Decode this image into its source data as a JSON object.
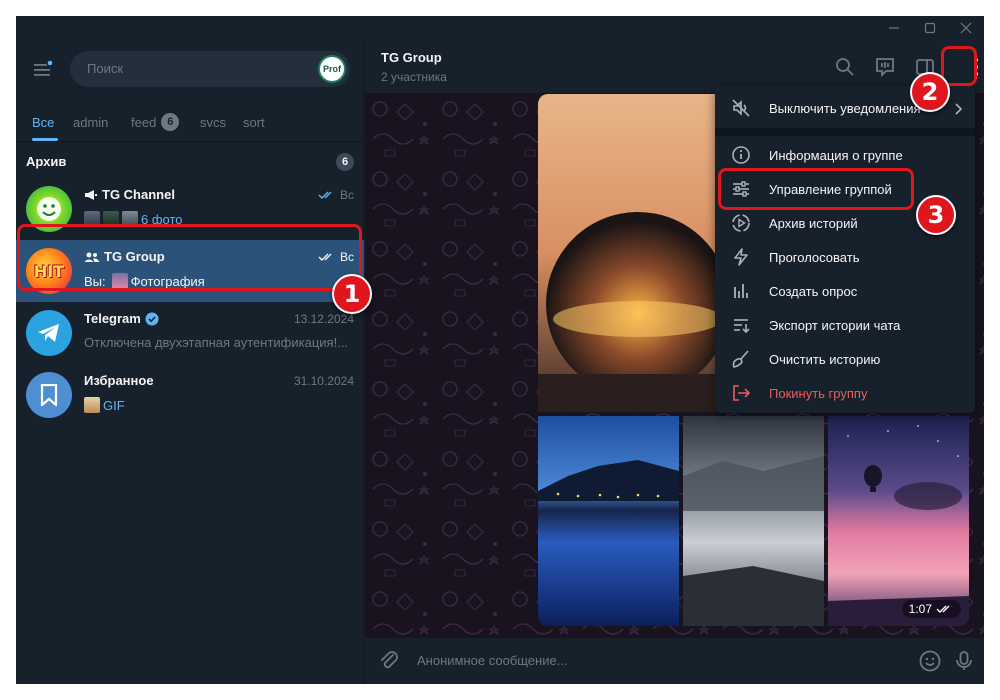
{
  "window": {
    "controls": {
      "minimize": "—",
      "maximize": "☐",
      "close": "✕"
    }
  },
  "sidebar": {
    "search_placeholder": "Поиск",
    "avatar_text": "Prof",
    "tabs": [
      {
        "label": "Все",
        "active": true
      },
      {
        "label": "admin"
      },
      {
        "label": "feed",
        "badge": "6"
      },
      {
        "label": "svcs"
      },
      {
        "label": "sort"
      }
    ],
    "archive": {
      "label": "Архив",
      "badge": "6"
    },
    "chats": [
      {
        "name": "TG Channel",
        "time": "Вс",
        "preview_link": "6 фото"
      },
      {
        "name": "TG Group",
        "time": "Вс",
        "preview_prefix": "Вы:",
        "preview_text": "Фотография",
        "avatar_text": "HIT"
      },
      {
        "name": "Telegram",
        "time": "13.12.2024",
        "preview_text": "Отключена двухэтапная аутентификация!..."
      },
      {
        "name": "Избранное",
        "time": "31.10.2024",
        "preview_link": "GIF"
      }
    ]
  },
  "chat_header": {
    "title": "TG Group",
    "subtitle": "2 участника"
  },
  "media": {
    "video_duration": "1:07"
  },
  "composer": {
    "placeholder": "Анонимное сообщение..."
  },
  "context_menu": {
    "items": [
      {
        "label": "Выключить уведомления",
        "icon": "mute-icon"
      },
      {
        "label": "Информация о группе",
        "icon": "info-icon"
      },
      {
        "label": "Управление группой",
        "icon": "settings-sliders-icon"
      },
      {
        "label": "Архив историй",
        "icon": "stories-archive-icon"
      },
      {
        "label": "Проголосовать",
        "icon": "lightning-icon"
      },
      {
        "label": "Создать опрос",
        "icon": "poll-icon"
      },
      {
        "label": "Экспорт истории чата",
        "icon": "export-icon"
      },
      {
        "label": "Очистить историю",
        "icon": "broom-icon"
      },
      {
        "label": "Покинуть группу",
        "icon": "leave-icon",
        "danger": true
      }
    ]
  },
  "annotations": {
    "step1": "1",
    "step2": "2",
    "step3": "3"
  },
  "colors": {
    "accent": "#5eb5f7",
    "selected": "#2b5278",
    "danger": "#ef5b5b",
    "annotation": "#e0161e"
  }
}
